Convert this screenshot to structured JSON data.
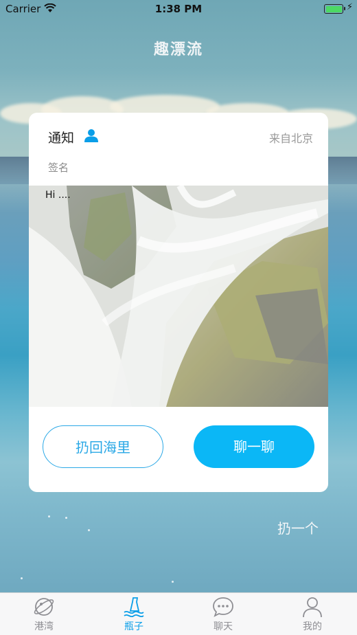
{
  "status_bar": {
    "carrier": "Carrier",
    "time": "1:38 PM"
  },
  "nav": {
    "title": "趣漂流"
  },
  "card": {
    "author": "通知",
    "location": "来自北京",
    "signature": "签名",
    "message": "Hi ....",
    "buttons": {
      "return": "扔回海里",
      "chat": "聊一聊"
    }
  },
  "throw_label": "扔一个",
  "tabs": [
    {
      "label": "港湾",
      "icon": "planet-icon",
      "active": false
    },
    {
      "label": "瓶子",
      "icon": "bottle-icon",
      "active": true
    },
    {
      "label": "聊天",
      "icon": "chat-bubble-icon",
      "active": false
    },
    {
      "label": "我的",
      "icon": "person-icon",
      "active": false
    }
  ],
  "colors": {
    "accent": "#0bb7f6",
    "tab_active": "#0a9ee8",
    "battery": "#4cd964"
  }
}
